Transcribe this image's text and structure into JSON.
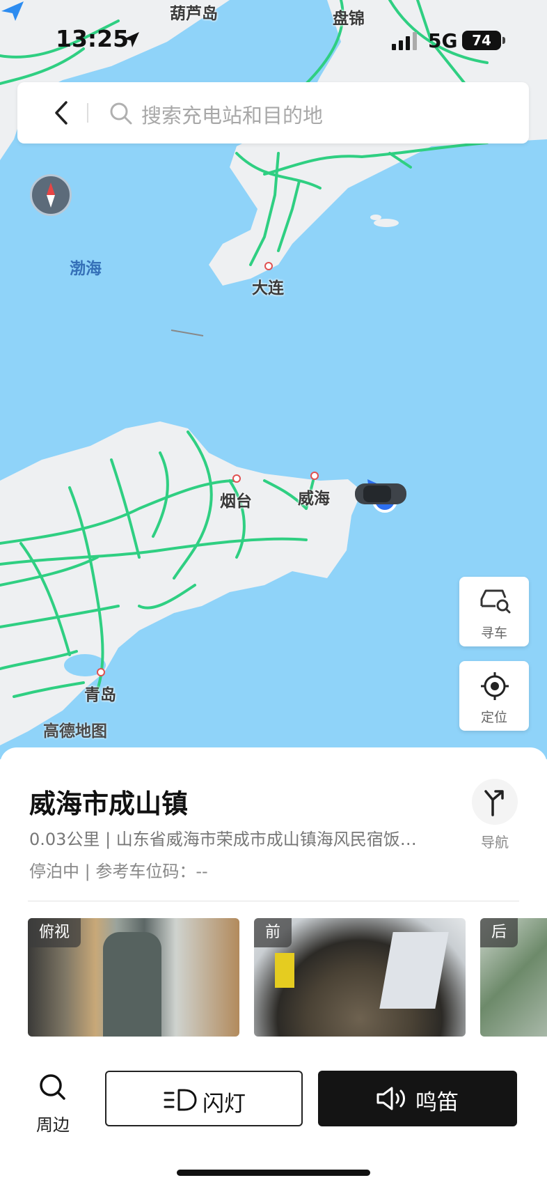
{
  "status_bar": {
    "time": "13:25",
    "network": "5G",
    "battery": "74"
  },
  "search": {
    "placeholder": "搜索充电站和目的地"
  },
  "map": {
    "labels": {
      "huludao": "葫芦岛",
      "panjin": "盘锦",
      "bohai": "渤海",
      "dalian": "大连",
      "yantai": "烟台",
      "weihai": "威海",
      "qingdao": "青岛"
    },
    "logo_text": "高德地图"
  },
  "map_buttons": {
    "find_car": "寻车",
    "locate": "定位"
  },
  "place": {
    "title": "威海市成山镇",
    "address": "0.03公里 | 山东省威海市荣成市成山镇海风民宿饭…",
    "status": "停泊中 | 参考车位码：--",
    "navigate": "导航"
  },
  "cameras": [
    {
      "label": "俯视"
    },
    {
      "label": "前"
    },
    {
      "label": "后"
    }
  ],
  "actions": {
    "around": "周边",
    "flash": "闪灯",
    "horn": "鸣笛"
  },
  "colors": {
    "sea": "#8fd3f9",
    "land": "#eef0f2",
    "road": "#2fcf82",
    "dark_button": "#141414"
  }
}
